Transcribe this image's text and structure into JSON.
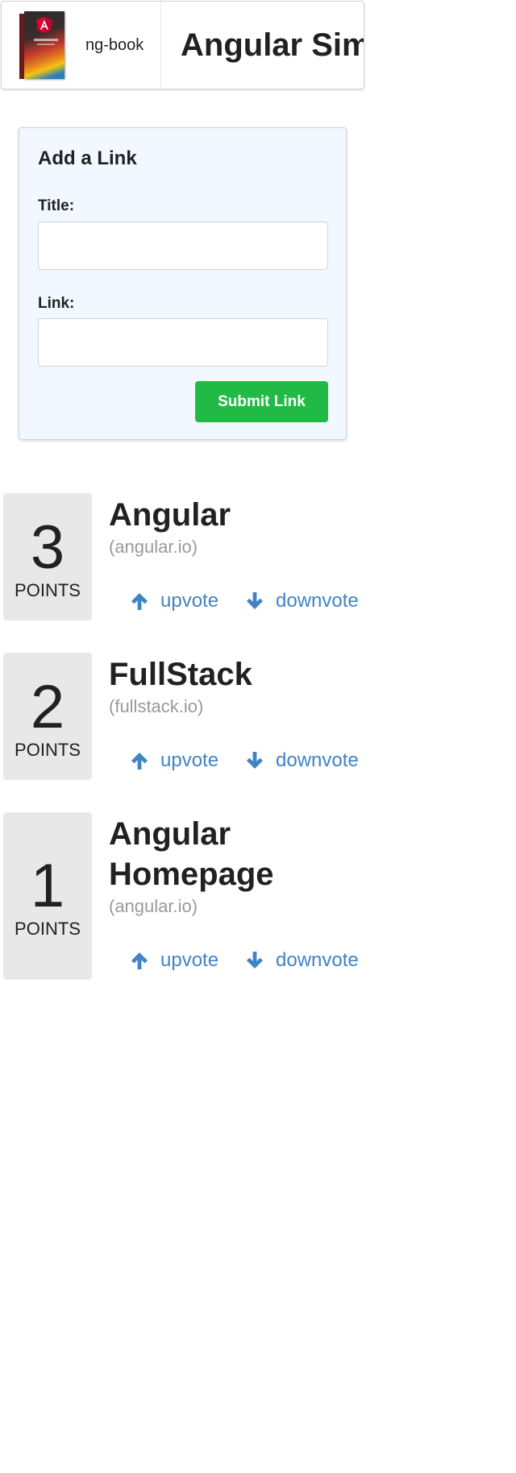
{
  "header": {
    "brand_label": "ng-book",
    "title": "Angular Simple Reddit"
  },
  "form": {
    "heading": "Add a Link",
    "title_label": "Title:",
    "title_value": "",
    "link_label": "Link:",
    "link_value": "",
    "submit_label": "Submit Link",
    "submit_color": "#21ba45"
  },
  "articles": [
    {
      "votes": "3",
      "points_label": "POINTS",
      "title": "Angular",
      "domain": "(angular.io)",
      "upvote_label": "upvote",
      "downvote_label": "downvote"
    },
    {
      "votes": "2",
      "points_label": "POINTS",
      "title": "FullStack",
      "domain": "(fullstack.io)",
      "upvote_label": "upvote",
      "downvote_label": "downvote"
    },
    {
      "votes": "1",
      "points_label": "POINTS",
      "title": "Angular Homepage",
      "domain": "(angular.io)",
      "upvote_label": "upvote",
      "downvote_label": "downvote"
    }
  ],
  "icons": {
    "upvote": "arrow-up-icon",
    "downvote": "arrow-down-icon",
    "logo": "ng-book-cover-icon"
  },
  "colors": {
    "link": "#4183c4",
    "form_background": "#f1f8ff",
    "votes_background": "#e8e8e8",
    "domain_text": "#999999"
  }
}
